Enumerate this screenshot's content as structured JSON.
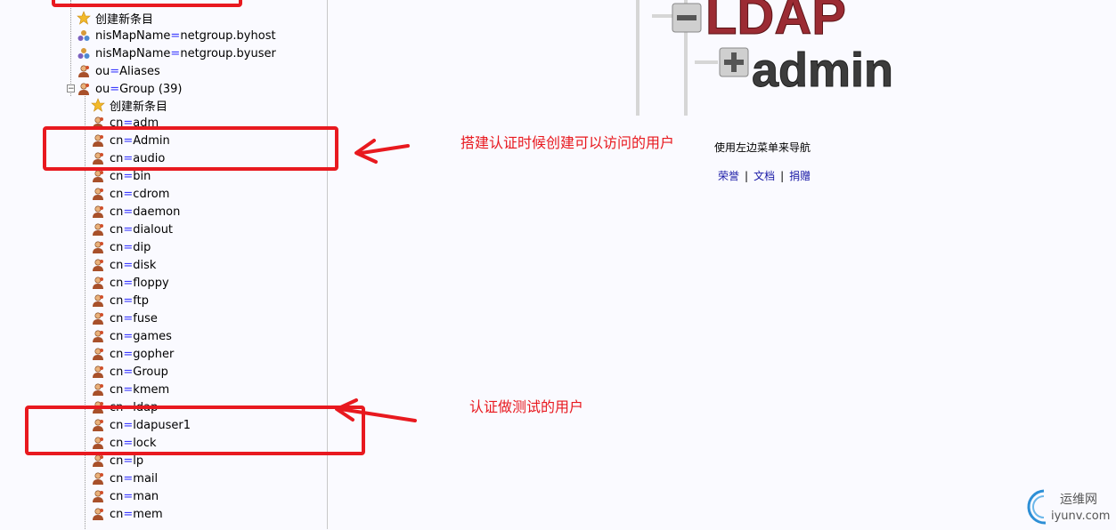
{
  "tree": {
    "top_items": [
      {
        "type": "star",
        "text": "创建新条目"
      },
      {
        "type": "map",
        "prefix": "nisMapName",
        "value": "netgroup.byhost"
      },
      {
        "type": "map",
        "prefix": "nisMapName",
        "value": "netgroup.byuser"
      },
      {
        "type": "person",
        "prefix": "ou",
        "value": "Aliases"
      },
      {
        "type": "person",
        "prefix": "ou",
        "value": "Group (39)"
      }
    ],
    "group_items": [
      {
        "type": "star",
        "text": "创建新条目"
      },
      {
        "type": "person",
        "prefix": "cn",
        "value": "adm"
      },
      {
        "type": "person",
        "prefix": "cn",
        "value": "Admin"
      },
      {
        "type": "person",
        "prefix": "cn",
        "value": "audio"
      },
      {
        "type": "person",
        "prefix": "cn",
        "value": "bin"
      },
      {
        "type": "person",
        "prefix": "cn",
        "value": "cdrom"
      },
      {
        "type": "person",
        "prefix": "cn",
        "value": "daemon"
      },
      {
        "type": "person",
        "prefix": "cn",
        "value": "dialout"
      },
      {
        "type": "person",
        "prefix": "cn",
        "value": "dip"
      },
      {
        "type": "person",
        "prefix": "cn",
        "value": "disk"
      },
      {
        "type": "person",
        "prefix": "cn",
        "value": "floppy"
      },
      {
        "type": "person",
        "prefix": "cn",
        "value": "ftp"
      },
      {
        "type": "person",
        "prefix": "cn",
        "value": "fuse"
      },
      {
        "type": "person",
        "prefix": "cn",
        "value": "games"
      },
      {
        "type": "person",
        "prefix": "cn",
        "value": "gopher"
      },
      {
        "type": "person",
        "prefix": "cn",
        "value": "Group"
      },
      {
        "type": "person",
        "prefix": "cn",
        "value": "kmem"
      },
      {
        "type": "person",
        "prefix": "cn",
        "value": "ldap"
      },
      {
        "type": "person",
        "prefix": "cn",
        "value": "ldapuser1"
      },
      {
        "type": "person",
        "prefix": "cn",
        "value": "lock"
      },
      {
        "type": "person",
        "prefix": "cn",
        "value": "lp"
      },
      {
        "type": "person",
        "prefix": "cn",
        "value": "mail"
      },
      {
        "type": "person",
        "prefix": "cn",
        "value": "man"
      },
      {
        "type": "person",
        "prefix": "cn",
        "value": "mem"
      }
    ]
  },
  "logo": {
    "line1": "LDAP",
    "line2": "admin"
  },
  "main": {
    "nav_hint": "使用左边菜单来导航",
    "links": [
      "荣誉",
      "文档",
      "捐赠"
    ]
  },
  "annotations": {
    "note1": "搭建认证时候创建可以访问的用户",
    "note2": "认证做测试的用户"
  },
  "watermark": {
    "cn": "运维网",
    "en": "iyunv.com"
  },
  "colors": {
    "annotation": "#e8191f",
    "link": "#1a1aa6",
    "logo_red": "#9b2b33",
    "logo_dark": "#3c3c3c"
  }
}
